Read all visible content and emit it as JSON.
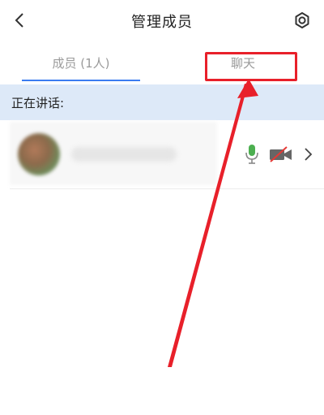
{
  "header": {
    "title": "管理成员"
  },
  "tabs": [
    {
      "label": "成员 (1人)",
      "active": true
    },
    {
      "label": "聊天",
      "active": false
    }
  ],
  "speaking_section": {
    "label": "正在讲话:"
  },
  "colors": {
    "accent": "#3b7cf0",
    "highlight": "#e8202a",
    "section_bg": "#dde9f8",
    "mic_green": "#4caf50",
    "camera_off_red": "#e53935"
  },
  "icons": {
    "back": "chevron-left-icon",
    "settings": "gear-icon",
    "mic": "microphone-icon",
    "camera": "camera-off-icon",
    "row_arrow": "chevron-right-icon"
  }
}
